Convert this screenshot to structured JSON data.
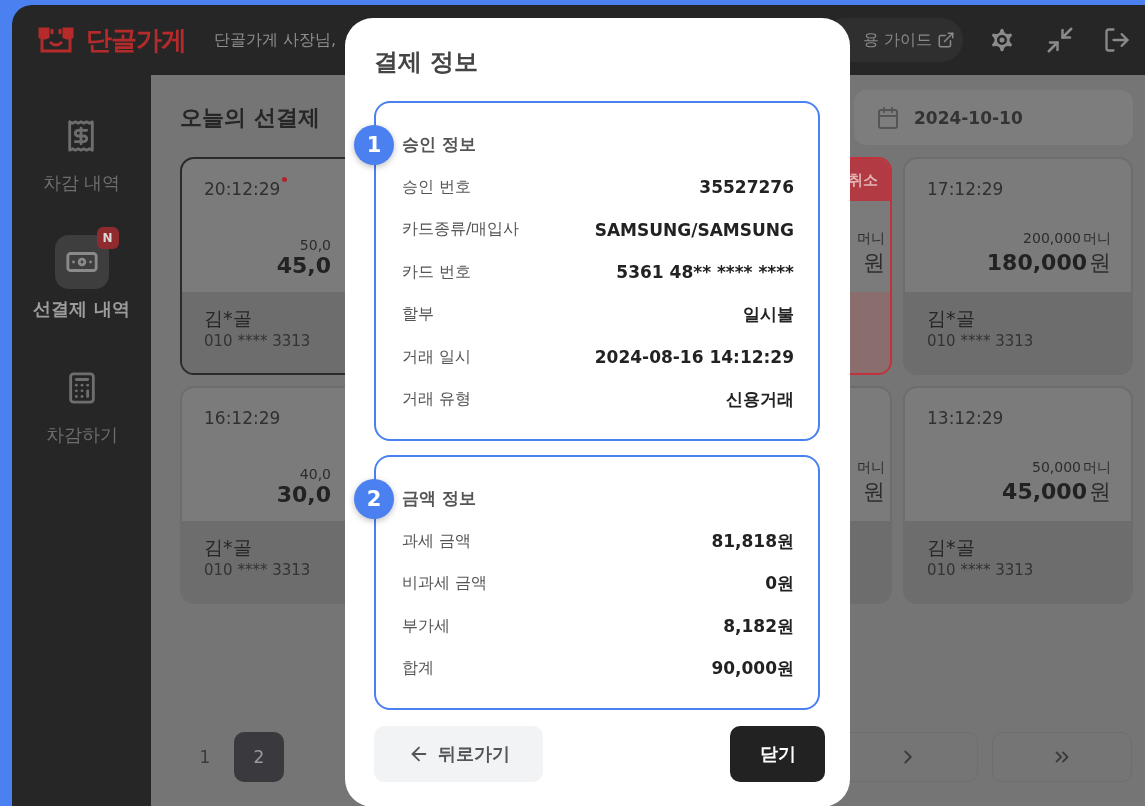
{
  "header": {
    "brand": "단골가게",
    "greeting": "단골가게 사장님,",
    "guide_button": "용 가이드"
  },
  "sidebar": {
    "items": [
      {
        "kind": "receipt",
        "label": "차감 내역",
        "selected": false
      },
      {
        "kind": "money",
        "label": "선결제 내역",
        "selected": true,
        "badge": "N"
      },
      {
        "kind": "register",
        "label": "차감하기",
        "selected": false
      }
    ]
  },
  "content": {
    "title": "오늘의 선결제",
    "date": "2024-10-10",
    "card_rows": [
      {
        "cards": [
          {
            "kind": "covered",
            "time": "20:12:29",
            "new": true,
            "original": "50,0",
            "amount": "45,0",
            "name": "김*골",
            "phone": "010 **** 3313",
            "selected": true,
            "canceled": false
          },
          {
            "kind": "partial",
            "badge": "취소",
            "original_unit": "머니",
            "amount_unit": "원",
            "selected": false,
            "canceled": true
          },
          {
            "kind": "full",
            "time": "17:12:29",
            "new": false,
            "original": "200,000",
            "original_unit": "머니",
            "amount": "180,000",
            "amount_unit": "원",
            "name": "김*골",
            "phone": "010 **** 3313",
            "selected": false,
            "canceled": false
          }
        ]
      },
      {
        "cards": [
          {
            "kind": "covered",
            "time": "16:12:29",
            "new": false,
            "original": "40,0",
            "amount": "30,0",
            "name": "김*골",
            "phone": "010 **** 3313",
            "selected": false,
            "canceled": false
          },
          {
            "kind": "partial",
            "original_unit": "머니",
            "amount_unit": "원",
            "selected": false,
            "canceled": false
          },
          {
            "kind": "full",
            "time": "13:12:29",
            "new": false,
            "original": "50,000",
            "original_unit": "머니",
            "amount": "45,000",
            "amount_unit": "원",
            "name": "김*골",
            "phone": "010 **** 3313",
            "selected": false,
            "canceled": false
          }
        ]
      }
    ],
    "pagination": {
      "pages": [
        {
          "label": "1",
          "selected": false
        },
        {
          "label": "2",
          "selected": true
        }
      ]
    }
  },
  "modal": {
    "title": "결제 정보",
    "sections": [
      {
        "number": "1",
        "title": "승인 정보",
        "rows": [
          {
            "label": "승인 번호",
            "value": "35527276"
          },
          {
            "label": "카드종류/매입사",
            "value": "SAMSUNG/SAMSUNG"
          },
          {
            "label": "카드 번호",
            "value": "5361 48** **** ****"
          },
          {
            "label": "할부",
            "value": "일시불"
          },
          {
            "label": "거래 일시",
            "value": "2024-08-16 14:12:29"
          },
          {
            "label": "거래 유형",
            "value": "신용거래"
          }
        ]
      },
      {
        "number": "2",
        "title": "금액 정보",
        "rows": [
          {
            "label": "과세 금액",
            "value": "81,818원"
          },
          {
            "label": "비과세 금액",
            "value": "0원"
          },
          {
            "label": "부가세",
            "value": "8,182원"
          },
          {
            "label": "합계",
            "value": "90,000원"
          }
        ]
      }
    ],
    "back_button": "뒤로가기",
    "close_button": "닫기"
  }
}
